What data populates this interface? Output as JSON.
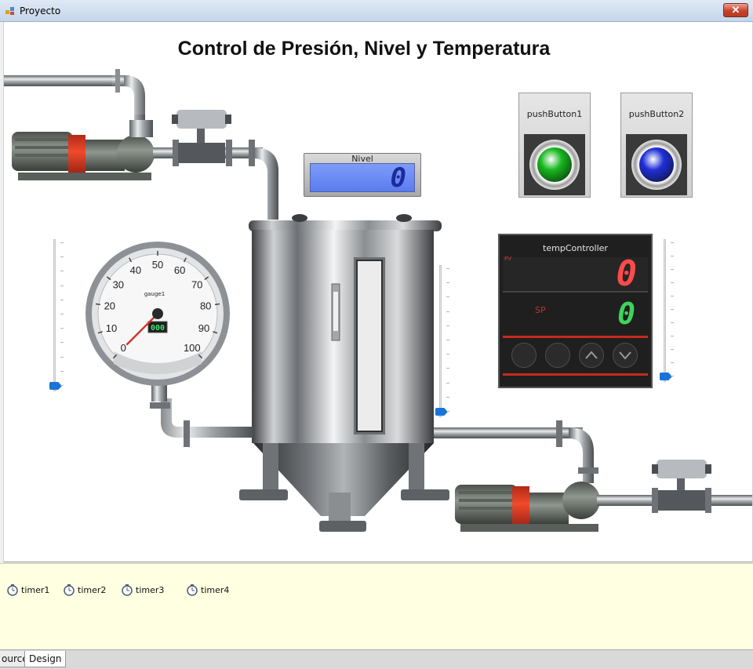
{
  "window": {
    "title": "Proyecto",
    "close_glyph": "✕"
  },
  "form": {
    "title": "Control de Presión, Nivel y Temperatura"
  },
  "level_display": {
    "label": "Nivel",
    "value": "0"
  },
  "push_buttons": [
    {
      "label": "pushButton1",
      "color": "#16b81e"
    },
    {
      "label": "pushButton2",
      "color": "#1f2fd6"
    }
  ],
  "gauge": {
    "name": "gauge1",
    "ticks": [
      "0",
      "10",
      "20",
      "30",
      "40",
      "50",
      "60",
      "70",
      "80",
      "90",
      "100"
    ],
    "readout": "000",
    "value": 0
  },
  "temp_controller": {
    "title": "tempController",
    "pv_label": "PV",
    "pv_value": "0",
    "sp_label": "SP",
    "sp_value": "0"
  },
  "sliders": [
    {
      "name": "slider-left",
      "level": 0
    },
    {
      "name": "slider-middle",
      "level": 0
    },
    {
      "name": "slider-right",
      "level": 0
    }
  ],
  "tray": {
    "items": [
      {
        "label": "timer1",
        "icon": "stopwatch-icon"
      },
      {
        "label": "timer2",
        "icon": "stopwatch-icon"
      },
      {
        "label": "timer3",
        "icon": "stopwatch-icon"
      },
      {
        "label": "timer4",
        "icon": "stopwatch-icon"
      }
    ]
  },
  "tabs": [
    {
      "label": "ource",
      "active": false
    },
    {
      "label": "Design",
      "active": true
    }
  ],
  "colors": {
    "pv": "#ff4a4a",
    "sp": "#3fd35b",
    "slider_thumb": "#1a73d9",
    "tray": "#ffffe1"
  }
}
